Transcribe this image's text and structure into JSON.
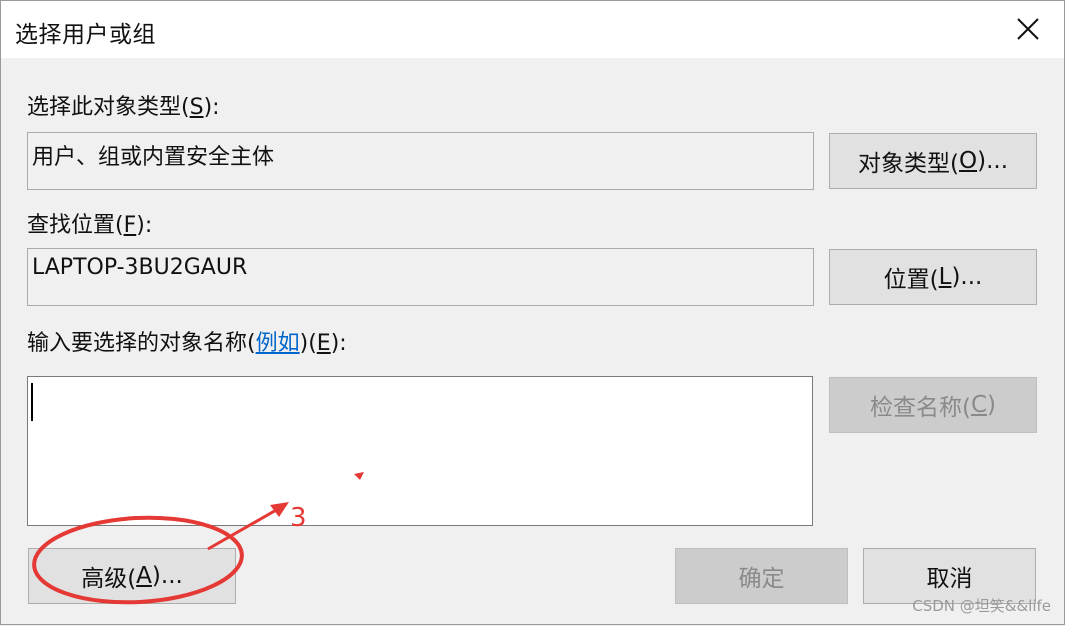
{
  "window": {
    "title": "选择用户或组",
    "close_icon": "close-icon"
  },
  "object_type": {
    "label_prefix": "选择此对象类型(",
    "label_mnemonic": "S",
    "label_suffix": "):",
    "value": "用户、组或内置安全主体",
    "button_prefix": "对象类型(",
    "button_mnemonic": "O",
    "button_suffix": ")..."
  },
  "location": {
    "label_prefix": "查找位置(",
    "label_mnemonic": "F",
    "label_suffix": "):",
    "value": "LAPTOP-3BU2GAUR",
    "button_prefix": "位置(",
    "button_mnemonic": "L",
    "button_suffix": ")..."
  },
  "object_names": {
    "label_prefix": "输入要选择的对象名称(",
    "example_link": "例如",
    "label_middle": ")(",
    "label_mnemonic": "E",
    "label_suffix": "):",
    "value": "",
    "check_button_prefix": "检查名称(",
    "check_button_mnemonic": "C",
    "check_button_suffix": ")"
  },
  "footer": {
    "advanced_prefix": "高级(",
    "advanced_mnemonic": "A",
    "advanced_suffix": ")...",
    "ok_label": "确定",
    "cancel_label": "取消"
  },
  "annotation": {
    "number": "3",
    "color": "#e53935"
  },
  "watermark": "CSDN @坦笑&&life"
}
